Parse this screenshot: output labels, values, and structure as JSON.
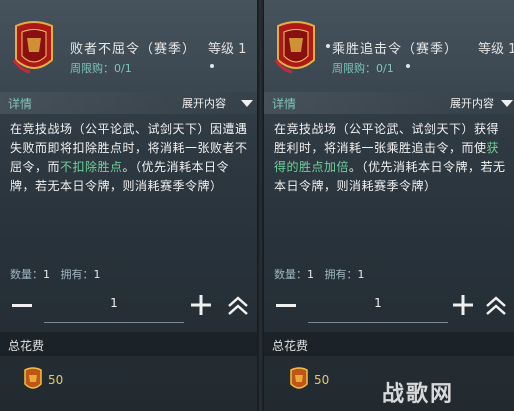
{
  "left": {
    "title": "败者不屈令（赛季）",
    "level": "等级 1",
    "weekly_limit": "周限购：0/1",
    "detail_label": "详情",
    "expand_label": "展开内容",
    "desc_a": "在竞技战场（公平论武、试剑天下）因遭遇失败而即将扣除胜点时，将消耗一张败者不屈令，而",
    "desc_hl": "不扣除胜点",
    "desc_b": "。（优先消耗本日令牌，若无本日令牌，则消耗赛季令牌）",
    "qty_label": "数量：",
    "qty_val": "1",
    "own_label": "拥有：",
    "own_val": "1",
    "stepper_value": "1",
    "cost_label": "总花费",
    "cost_value": "50"
  },
  "right": {
    "title": "乘胜追击令（赛季）",
    "level": "等级 1",
    "weekly_limit": "周限购：0/1",
    "detail_label": "详情",
    "expand_label": "展开内容",
    "desc_a": "在竞技战场（公平论武、试剑天下）获得胜利时，将消耗一张乘胜追击令，而使",
    "desc_hl": "获得的胜点加倍",
    "desc_b": "。（优先消耗本日令牌，若无本日令牌，则消耗赛季令牌）",
    "qty_label": "数量：",
    "qty_val": "1",
    "own_label": "拥有：",
    "own_val": "1",
    "stepper_value": "1",
    "cost_label": "总花费",
    "cost_value": "50"
  },
  "watermark": "战歌网",
  "colors": {
    "accent_teal": "#7fc4b9",
    "highlight_green": "#6fd19a",
    "gold": "#e8c66a"
  }
}
